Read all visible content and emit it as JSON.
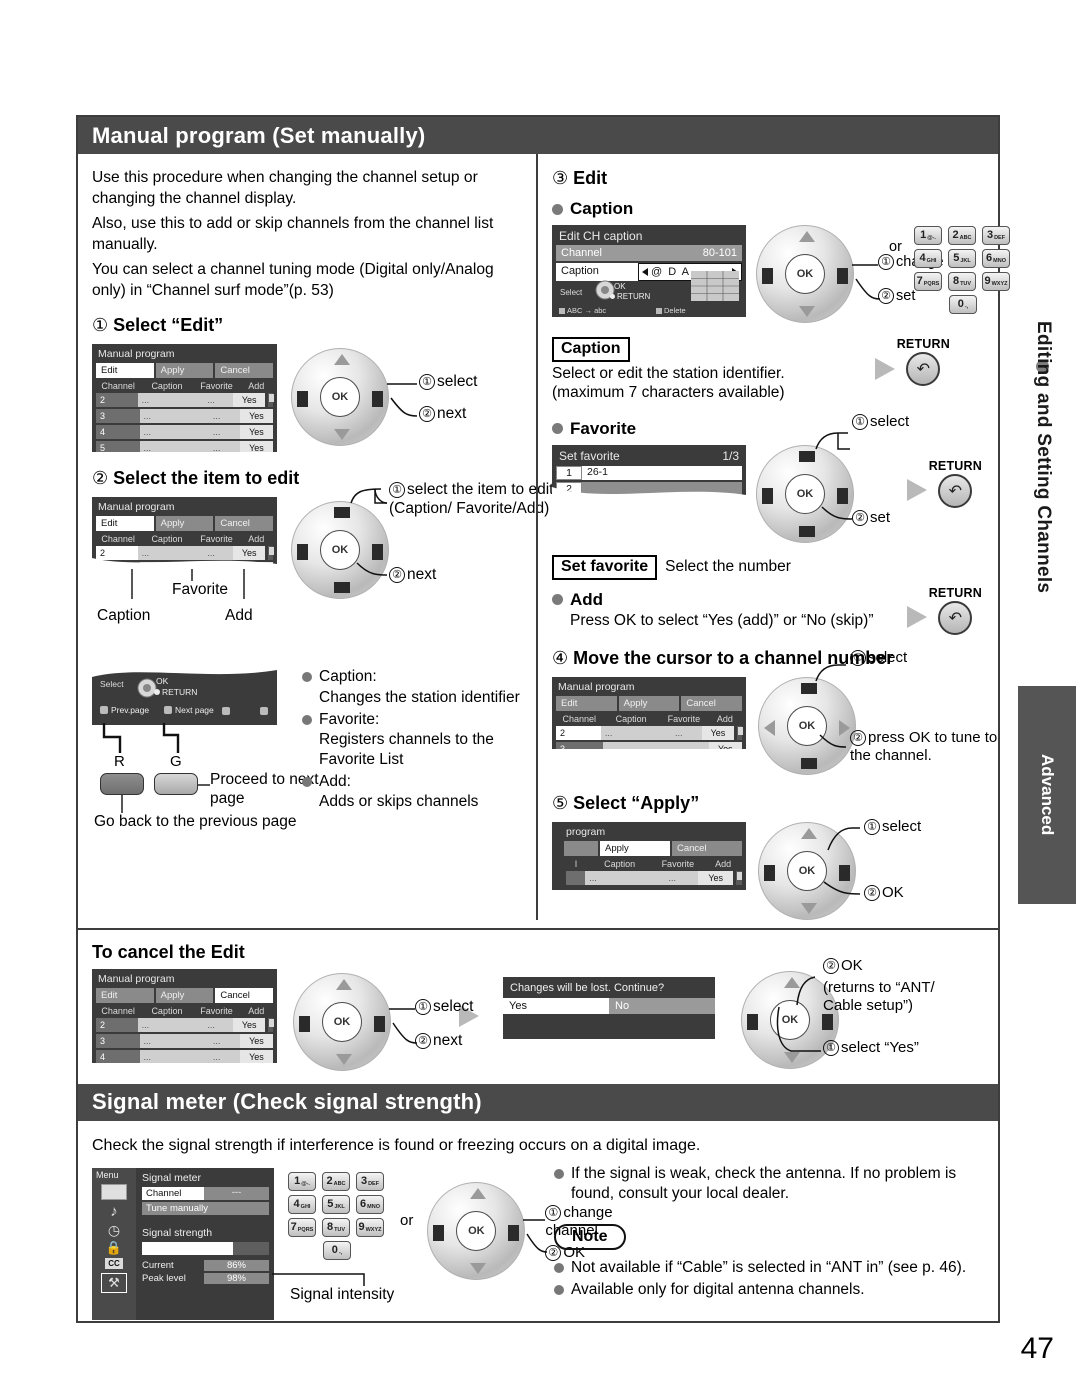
{
  "sidebar": {
    "vertical_label": "Editing and Setting Channels",
    "advanced_label": "Advanced"
  },
  "page_number": "47",
  "section1": {
    "heading": "Manual program (Set manually)",
    "intro": [
      "Use this procedure when changing the channel setup or changing the channel display.",
      "Also, use this to add or skip channels from the channel list manually.",
      "You can select a channel tuning mode (Digital only/Analog only) in “Channel surf mode”(p. 53)"
    ],
    "step1": {
      "number": "①",
      "title": "Select “Edit”",
      "callouts": [
        "select",
        "next"
      ],
      "callout_numbers": [
        "①",
        "②"
      ]
    },
    "step2": {
      "number": "②",
      "title": "Select the item to edit",
      "callout1": "select the item to edit (Caption/ Favorite/Add)",
      "callout2": "next",
      "col_labels": {
        "caption": "Caption",
        "favorite": "Favorite",
        "add": "Add"
      },
      "banner": {
        "select": "Select",
        "ok": "OK",
        "return": "RETURN",
        "prev_page": "Prev.page",
        "next_page": "Next page"
      },
      "buttons": {
        "red": "R",
        "green": "G"
      },
      "green_text": "Proceed to next page",
      "red_text": "Go back to the previous page",
      "definitions": [
        {
          "term": "Caption:",
          "desc": "Changes the station identifier"
        },
        {
          "term": "Favorite:",
          "desc": "Registers channels to the Favorite List"
        },
        {
          "term": "Add:",
          "desc": "Adds or skips channels"
        }
      ]
    },
    "step3": {
      "number": "③",
      "title": "Edit",
      "caption_bullet": "Caption",
      "screen": {
        "title": "Edit CH caption",
        "rows": [
          {
            "label": "Channel",
            "value": "80-101"
          },
          {
            "label": "Caption",
            "value": "@ D A"
          }
        ],
        "select": "Select",
        "ok": "OK",
        "return": "RETURN",
        "abc": "ABC → abc",
        "delete": "Delete"
      },
      "callouts": [
        "change",
        "set"
      ],
      "or_label": "or",
      "caption_box": "Caption",
      "caption_desc": "Select or edit the station identifier. (maximum 7 characters available)",
      "return_label": "RETURN",
      "favorite_bullet": "Favorite",
      "favorite_screen": {
        "title": "Set favorite",
        "page": "1/3",
        "row1_num": "1",
        "row1_val": "26-1",
        "row2_num": "2"
      },
      "favorite_callouts": [
        "select",
        "set"
      ],
      "setfav_box": "Set favorite",
      "setfav_desc": "Select the number",
      "add_bullet": "Add",
      "add_desc": "Press OK to select “Yes (add)” or “No (skip)”"
    },
    "step4": {
      "number": "④",
      "title": "Move the cursor to a channel number",
      "callout1": "select",
      "callout2": "press OK to tune to the channel."
    },
    "step5": {
      "number": "⑤",
      "title": "Select “Apply”",
      "callout1": "select",
      "callout2": "OK",
      "screen_title": "program"
    },
    "cancel": {
      "title": "To cancel the Edit",
      "callouts": [
        "select",
        "next"
      ],
      "dialog": {
        "text": "Changes will be lost. Continue?",
        "yes": "Yes",
        "no": "No"
      },
      "callout_ok": "OK",
      "callout_ok_desc": "(returns to “ANT/ Cable setup”)",
      "callout_yes": "select “Yes”"
    },
    "menu": {
      "tabs": {
        "edit": "Edit",
        "apply": "Apply",
        "cancel": "Cancel"
      },
      "columns": [
        "Channel",
        "Caption",
        "Favorite",
        "Add"
      ],
      "rows": [
        {
          "ch": "2",
          "cap": "...",
          "fav": "...",
          "add": "Yes"
        },
        {
          "ch": "3",
          "cap": "...",
          "fav": "...",
          "add": "Yes"
        },
        {
          "ch": "4",
          "cap": "...",
          "fav": "...",
          "add": "Yes"
        },
        {
          "ch": "5",
          "cap": "...",
          "fav": "...",
          "add": "Yes"
        }
      ],
      "title": "Manual program"
    }
  },
  "section2": {
    "heading": "Signal meter (Check signal strength)",
    "intro": "Check the signal strength if interference is found or freezing occurs on a digital image.",
    "screen": {
      "menu_label": "Menu",
      "title": "Signal meter",
      "channel_label": "Channel",
      "channel_value": "---",
      "tune_manually": "Tune manually",
      "signal_strength_label": "Signal strength",
      "current_label": "Current",
      "current_value": "86%",
      "peak_label": "Peak level",
      "peak_value": "98%"
    },
    "signal_intensity_label": "Signal intensity",
    "or_label": "or",
    "callout1": "change channel",
    "callout2": "OK",
    "tips": [
      "If the signal is weak, check the antenna. If no problem is found, consult your local dealer."
    ],
    "note_label": "Note",
    "notes": [
      "Not available if “Cable” is selected in “ANT in” (see p. 46).",
      "Available only for digital antenna channels."
    ]
  },
  "keypad": [
    {
      "n": "1",
      "s": "@-."
    },
    {
      "n": "2",
      "s": "ABC"
    },
    {
      "n": "3",
      "s": "DEF"
    },
    {
      "n": "4",
      "s": "GHI"
    },
    {
      "n": "5",
      "s": "JKL"
    },
    {
      "n": "6",
      "s": "MNO"
    },
    {
      "n": "7",
      "s": "PQRS"
    },
    {
      "n": "8",
      "s": "TUV"
    },
    {
      "n": "9",
      "s": "WXYZ"
    },
    {
      "n": "0",
      "s": "-,"
    }
  ]
}
